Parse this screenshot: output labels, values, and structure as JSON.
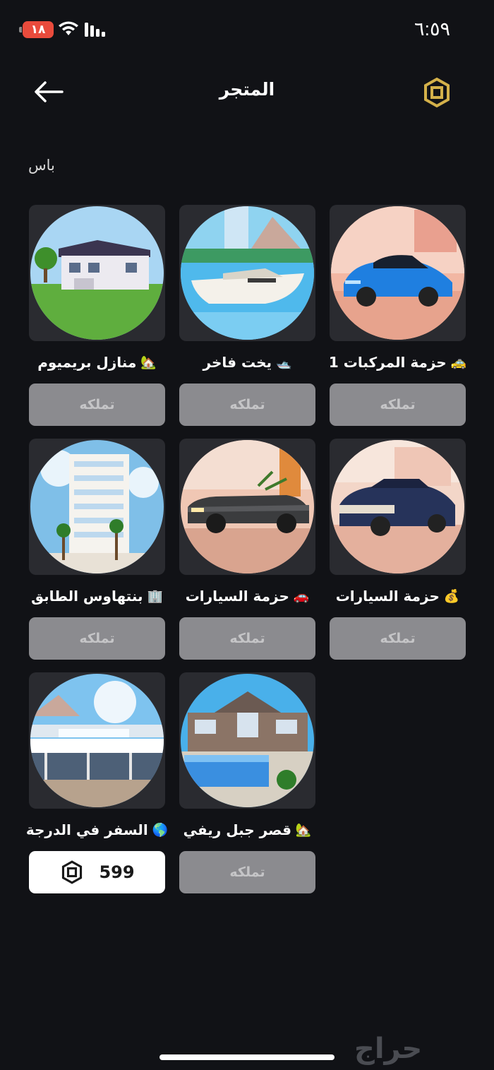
{
  "status": {
    "time": "٦:٥٩",
    "battery": "١٨"
  },
  "header": {
    "title": "المتجر"
  },
  "section": {
    "label": "باس"
  },
  "items": [
    {
      "title": "حزمة المركبات 1",
      "emoji": "🚕",
      "button": "تملكه",
      "image": "sports-car-image"
    },
    {
      "title": "يخت فاخر",
      "emoji": "🛥️",
      "button": "تملكه",
      "image": "yacht-image"
    },
    {
      "title": "منازل بريميوم",
      "emoji": "🏡",
      "button": "تملكه",
      "image": "premium-house-image"
    },
    {
      "title": "حزمة السيارات",
      "emoji": "💰",
      "button": "تملكه",
      "image": "luxury-sedan-image"
    },
    {
      "title": "حزمة السيارات",
      "emoji": "🚗",
      "button": "تملكه",
      "image": "convertible-car-image"
    },
    {
      "title": "بنتهاوس الطابق",
      "emoji": "🏢",
      "button": "تملكه",
      "image": "penthouse-tower-image"
    },
    {
      "title": "قصر جبل ريفي",
      "emoji": "🏡",
      "button": "تملكه",
      "image": "mountain-mansion-image"
    },
    {
      "title": "السفر في الدرجة",
      "emoji": "🌎",
      "button": "599",
      "image": "airport-image"
    }
  ],
  "watermark": "حراج",
  "colors": {
    "background": "#111216",
    "card": "#2a2b30",
    "button_disabled": "#8b8b8f",
    "button_price": "#ffffff",
    "robux_gold": "#d4b14a"
  }
}
